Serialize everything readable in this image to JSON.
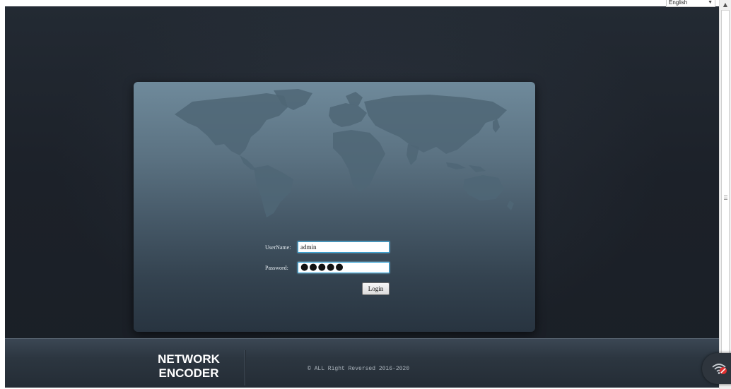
{
  "language_select": {
    "value": "English",
    "caret": "▼"
  },
  "login_form": {
    "username_label": "UserName:",
    "username_value": "admin",
    "password_label": "Password:",
    "password_value": "●●●●●",
    "login_button": "Login"
  },
  "footer": {
    "brand_line1": "NETWORK",
    "brand_line2": "ENCODER",
    "copyright": "©  ALL Right Reversed 2016-2020"
  },
  "icons": {
    "world_map": "world-map",
    "wifi": "wifi-off-icon",
    "scroll_up": "scroll-up-arrow-icon"
  },
  "colors": {
    "background": "#1c2129",
    "panel_top": "#6f8a9b",
    "panel_bottom": "#283440",
    "input_border": "#3aa6d8",
    "wifi_badge": "#e03030"
  }
}
